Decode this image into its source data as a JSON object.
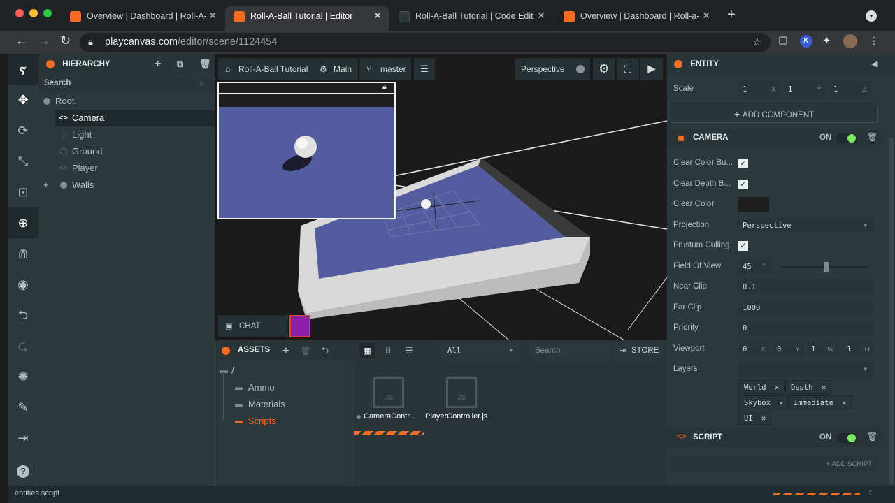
{
  "browser": {
    "tabs": [
      {
        "title": "Overview | Dashboard | Roll-A-",
        "active": false
      },
      {
        "title": "Roll-A-Ball Tutorial | Editor",
        "active": true
      },
      {
        "title": "Roll-A-Ball Tutorial | Code Edit",
        "active": false
      },
      {
        "title": "Overview | Dashboard | Roll-a-",
        "active": false
      }
    ],
    "url_domain": "playcanvas.com",
    "url_path": "/editor/scene/1124454",
    "profile_initial": "K"
  },
  "hierarchy": {
    "title": "HIERARCHY",
    "search_placeholder": "Search",
    "items": [
      {
        "label": "Root",
        "icon": "entity-dot-icon"
      },
      {
        "label": "Camera",
        "icon": "camera-code-icon",
        "selected": true
      },
      {
        "label": "Light",
        "icon": "light-icon"
      },
      {
        "label": "Ground",
        "icon": "ground-icon"
      },
      {
        "label": "Player",
        "icon": "player-code-icon"
      },
      {
        "label": "Walls",
        "icon": "entity-dot-icon"
      }
    ]
  },
  "viewport": {
    "project": "Roll-A-Ball Tutorial",
    "scene": "Main",
    "branch": "master",
    "camera_mode": "Perspective",
    "chat_label": "CHAT"
  },
  "assets": {
    "title": "ASSETS",
    "filter": "All",
    "search_placeholder": "Search",
    "store_label": "STORE",
    "root_folder": "/",
    "folders": [
      {
        "label": "Ammo",
        "active": false
      },
      {
        "label": "Materials",
        "active": false
      },
      {
        "label": "Scripts",
        "active": true
      }
    ],
    "files": [
      {
        "label": "CameraContr...",
        "type": "JS"
      },
      {
        "label": "PlayerController.js",
        "type": "JS"
      }
    ]
  },
  "inspector": {
    "title": "ENTITY",
    "scale_label": "Scale",
    "scale": {
      "x": "1",
      "y": "1",
      "z": "1"
    },
    "add_component": "ADD COMPONENT",
    "camera_section": "CAMERA",
    "on_label": "ON",
    "fields": {
      "clear_color_buffer": "Clear Color Bu...",
      "clear_depth_buffer": "Clear Depth B...",
      "clear_color": "Clear Color",
      "projection": "Projection",
      "projection_value": "Perspective",
      "frustum_culling": "Frustum Culling",
      "fov": "Field Of View",
      "fov_value": "45",
      "fov_unit": "°",
      "near_clip": "Near Clip",
      "near_clip_value": "0.1",
      "far_clip": "Far Clip",
      "far_clip_value": "1000",
      "priority": "Priority",
      "priority_value": "0",
      "viewport": "Viewport",
      "viewport_values": [
        "0",
        "0",
        "1",
        "1"
      ],
      "viewport_axes": [
        "X",
        "Y",
        "W",
        "H"
      ],
      "layers": "Layers"
    },
    "layer_tags": [
      "World",
      "Depth",
      "Skybox",
      "Immediate",
      "UI"
    ],
    "script_section": "SCRIPT",
    "add_script": "+ ADD SCRIPT"
  },
  "statusbar": {
    "text": "entities.script",
    "count": "1"
  },
  "colors": {
    "accent": "#f26d21",
    "panel": "#2c393c",
    "toggle_on": "#7cea5f",
    "plane": "#545ca0"
  }
}
